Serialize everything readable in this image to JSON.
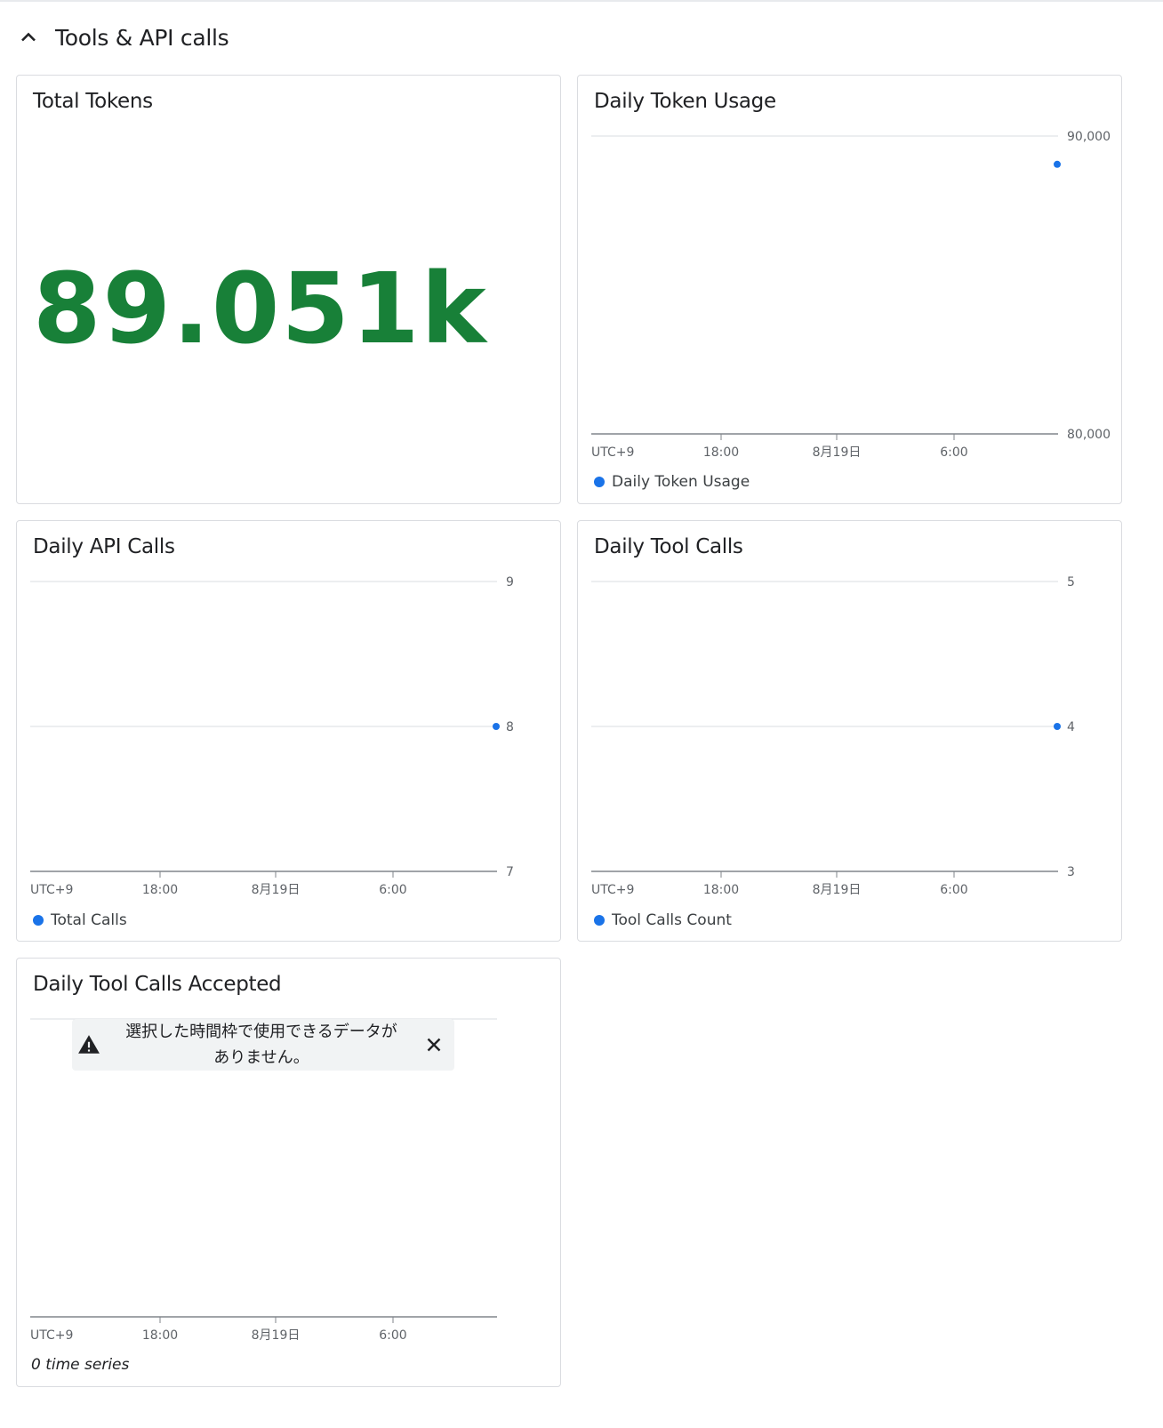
{
  "section": {
    "title": "Tools & API calls",
    "toggle_icon": "chevron-up-icon"
  },
  "total_tokens": {
    "title": "Total Tokens",
    "value": "89.051k",
    "value_color": "#188038"
  },
  "colors": {
    "series": "#1a73e8",
    "grid": "#dadce0",
    "axis": "#80868b"
  },
  "x_axis_labels": [
    "UTC+9",
    "18:00",
    "8月19日",
    "6:00"
  ],
  "daily_token_usage": {
    "title": "Daily Token Usage",
    "legend": "Daily Token Usage",
    "chart_data": {
      "type": "scatter",
      "title": "Daily Token Usage",
      "x": [
        "UTC+9",
        "18:00",
        "8月19日",
        "6:00"
      ],
      "y_ticks": [
        "90,000",
        "80,000"
      ],
      "ylim": [
        80000,
        90000
      ],
      "series": [
        {
          "name": "Daily Token Usage",
          "values": [
            89051
          ]
        }
      ],
      "grid": true
    }
  },
  "daily_api_calls": {
    "title": "Daily API Calls",
    "legend": "Total Calls",
    "chart_data": {
      "type": "scatter",
      "title": "Daily API Calls",
      "x": [
        "UTC+9",
        "18:00",
        "8月19日",
        "6:00"
      ],
      "y_ticks": [
        "9",
        "8",
        "7"
      ],
      "ylim": [
        7,
        9
      ],
      "series": [
        {
          "name": "Total Calls",
          "values": [
            8
          ]
        }
      ],
      "grid": true
    }
  },
  "daily_tool_calls": {
    "title": "Daily Tool Calls",
    "legend": "Tool Calls Count",
    "chart_data": {
      "type": "scatter",
      "title": "Daily Tool Calls",
      "x": [
        "UTC+9",
        "18:00",
        "8月19日",
        "6:00"
      ],
      "y_ticks": [
        "5",
        "4",
        "3"
      ],
      "ylim": [
        3,
        5
      ],
      "series": [
        {
          "name": "Tool Calls Count",
          "values": [
            4
          ]
        }
      ],
      "grid": true
    }
  },
  "daily_tool_calls_accepted": {
    "title": "Daily Tool Calls Accepted",
    "notice": {
      "line1": "選択した時間枠で使用できるデータが",
      "line2": "ありません。",
      "icon": "warning-icon",
      "close_icon": "close-icon"
    },
    "footer": "0 time series",
    "chart_data": {
      "type": "line",
      "title": "Daily Tool Calls Accepted",
      "x": [
        "UTC+9",
        "18:00",
        "8月19日",
        "6:00"
      ],
      "series": []
    }
  }
}
